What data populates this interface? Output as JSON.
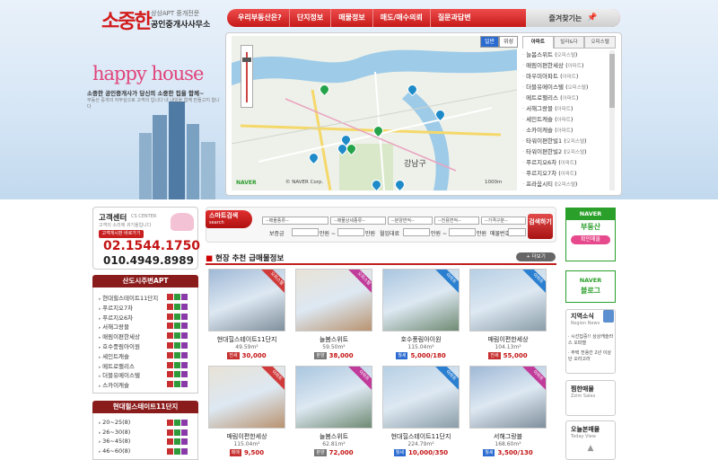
{
  "brand": {
    "mark": "소중한",
    "sub": "상상APT 중개전문",
    "name": "공인중개사사무소"
  },
  "nav": [
    "우리부동산은?",
    "단지정보",
    "매물정보",
    "매도/매수의뢰",
    "질문과답변"
  ],
  "favorite": "즐겨찾기는",
  "hero": {
    "title": "happy house",
    "slogan": "소중한 공인중개사가 당신의 소중한 집을 함께~",
    "slogan2": "부동산 중개의 자부심으로 고객의 입니다 내 내일을 함께 만들고지 합니다"
  },
  "map": {
    "types": [
      "일반",
      "위성"
    ],
    "logo": "NAVER",
    "copyright": "© NAVER Corp.",
    "scale": "1000m",
    "labels": [
      "강남구"
    ]
  },
  "apt_tabs": [
    "아파트",
    "빌라&다",
    "오피스텔"
  ],
  "apt_list": [
    [
      "늘봄스위트",
      "오피스텔"
    ],
    [
      "매림이편한세상",
      "아파트"
    ],
    [
      "마우미아파트",
      "아파트"
    ],
    [
      "더블유메이스텔",
      "오피스텔"
    ],
    [
      "메트로팰리스",
      "아파트"
    ],
    [
      "서해그랑블",
      "아파트"
    ],
    [
      "세인트캐슬",
      "아파트"
    ],
    [
      "소카이캐슬",
      "아파트"
    ],
    [
      "타워이편한빌1",
      "오피스텔"
    ],
    [
      "타워이편한빌2",
      "오피스텔"
    ],
    [
      "푸르지오6차",
      "아파트"
    ],
    [
      "푸르지오7차",
      "아파트"
    ],
    [
      "프라움시티",
      "오피스텔"
    ]
  ],
  "cs": {
    "title": "고객센터",
    "en": "CS CENTER",
    "sub": "고객의 소리에 귀기울입니다",
    "btn": "고객게시판 바로가기",
    "tel1": "02.1544.1750",
    "tel2": "010.4949.8989"
  },
  "box1": {
    "title": "산도시주변APT",
    "items": [
      "현대힐스테이트11단지",
      "푸르지오7차",
      "푸르지오6차",
      "서해그랑블",
      "매림이편한세상",
      "호수풍림아이원",
      "세인트캐슬",
      "메트로팰리스",
      "더블유메이스텔",
      "스카이캐슬"
    ]
  },
  "box2": {
    "title": "현대힐스테이트11단지",
    "items": [
      "20~25(8)",
      "26~30(8)",
      "36~45(8)",
      "46~60(8)"
    ]
  },
  "search": {
    "label": "스마트검색",
    "en": "search",
    "selects": [
      "--매물종류--",
      "--매물상세종류--",
      "--분양면적--",
      "--전용면적--",
      "--가격구분--"
    ],
    "labels": [
      "보증금",
      "만원 ~",
      "만원",
      "월임대료",
      "만원 ~",
      "만원",
      "매물번호"
    ],
    "btn": "검색하기"
  },
  "rec": {
    "title": "현장 추천 급매물정보",
    "dot": "■",
    "more": "+ 더보기"
  },
  "cards": [
    {
      "name": "현대힐스테이트11단지",
      "size": "49.59m²",
      "deal": "전세",
      "price": "30,000",
      "ribbon": "오피스텔",
      "rc": "#d03a3a"
    },
    {
      "name": "늘봄스위트",
      "size": "59.50m²",
      "deal": "분양",
      "price": "38,000",
      "ribbon": "오피스텔",
      "rc": "#c13b9a"
    },
    {
      "name": "호수풍림아이원",
      "size": "115.04m²",
      "deal": "월세",
      "price": "5,000/180",
      "ribbon": "아파트",
      "rc": "#2b7fd0"
    },
    {
      "name": "매림이편한세상",
      "size": "104.13m²",
      "deal": "전세",
      "price": "55,000",
      "ribbon": "아파트",
      "rc": "#2b7fd0"
    },
    {
      "name": "매림이편한세상",
      "size": "115.04m²",
      "deal": "매매",
      "price": "9,500",
      "ribbon": "아파트",
      "rc": "#d03a3a"
    },
    {
      "name": "늘봄스위트",
      "size": "62.81m²",
      "deal": "분양",
      "price": "72,000",
      "ribbon": "아파트",
      "rc": "#c13b9a"
    },
    {
      "name": "현대힐스테이트11단지",
      "size": "224.79m²",
      "deal": "월세",
      "price": "10,000/350",
      "ribbon": "아파트",
      "rc": "#2b7fd0"
    },
    {
      "name": "서해그랑블",
      "size": "168.60m²",
      "deal": "월세",
      "price": "3,500/130",
      "ribbon": "아파트",
      "rc": "#c13b9a"
    }
  ],
  "right": {
    "naver1_h": "NAVER",
    "naver1_t": "부동산",
    "naver1_b": "확인매물",
    "naver2_h": "NAVER",
    "naver2_t": "블로그",
    "region": "지역소식",
    "region_en": "Region News",
    "news": [
      "· 시선집중!! 상상캐슬라스 오피텔",
      "· 주택 전용칸 2년 이상 단 오라고라"
    ],
    "zzim": "찜한매물",
    "zzim_en": "Zzim Sales",
    "today": "오늘본매물",
    "today_en": "Today View",
    "arrow": "▲"
  }
}
